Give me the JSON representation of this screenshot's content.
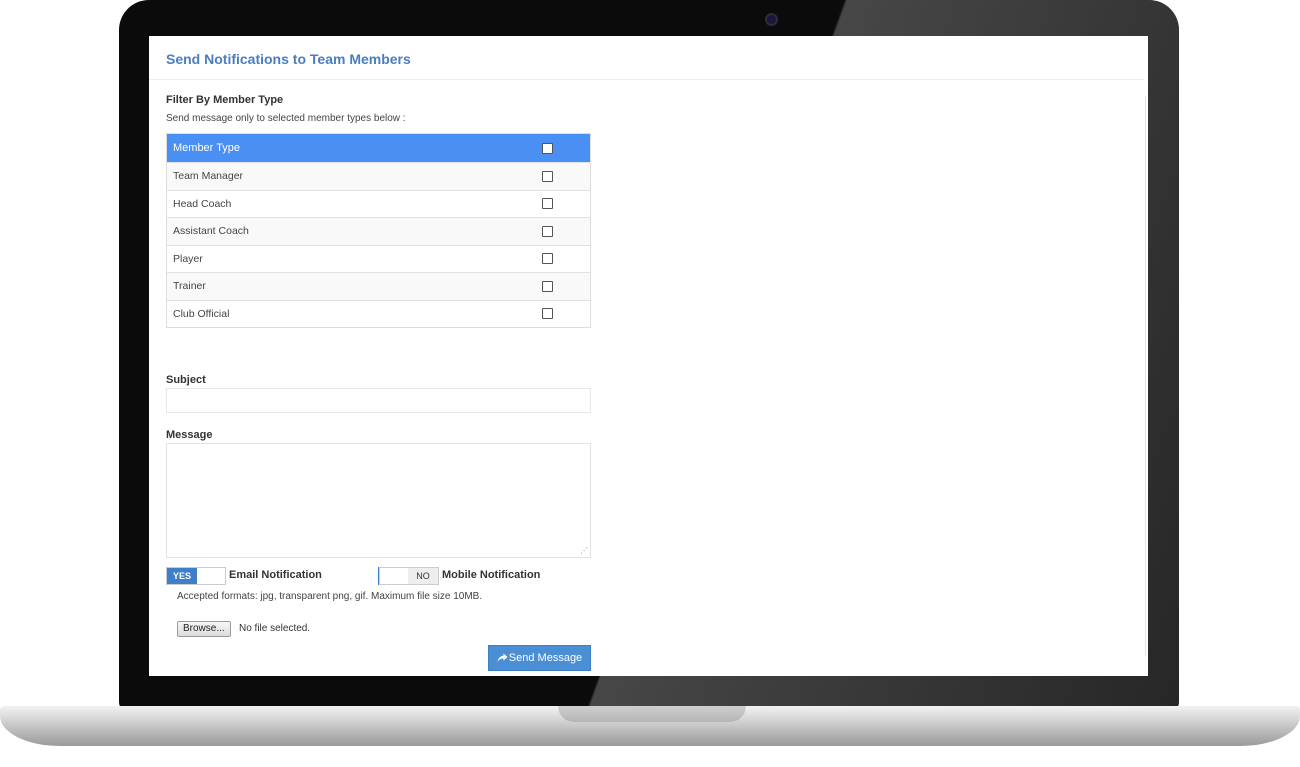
{
  "page": {
    "title": "Send Notifications to Team Members"
  },
  "filter": {
    "heading": "Filter By Member Type",
    "hint": "Send message only to selected member types below :",
    "header_label": "Member Type",
    "rows": [
      {
        "label": "Team Manager",
        "checked": false
      },
      {
        "label": "Head Coach",
        "checked": false
      },
      {
        "label": "Assistant Coach",
        "checked": false
      },
      {
        "label": "Player",
        "checked": false
      },
      {
        "label": "Trainer",
        "checked": false
      },
      {
        "label": "Club Official",
        "checked": false
      }
    ]
  },
  "subject": {
    "label": "Subject",
    "value": ""
  },
  "message": {
    "label": "Message",
    "value": ""
  },
  "email_toggle": {
    "state_text": "YES",
    "label": "Email Notification"
  },
  "mobile_toggle": {
    "state_text": "NO",
    "label": "Mobile Notification"
  },
  "attachment": {
    "formats_note": "Accepted formats: jpg, transparent png, gif. Maximum file size 10MB.",
    "browse_label": "Browse...",
    "file_status": "No file selected."
  },
  "actions": {
    "send_label": "Send Message"
  },
  "colors": {
    "title": "#4a7dc0",
    "table_header": "#4a8ff2",
    "toggle_on": "#3f7fc9",
    "send_button": "#4a8fd6"
  }
}
